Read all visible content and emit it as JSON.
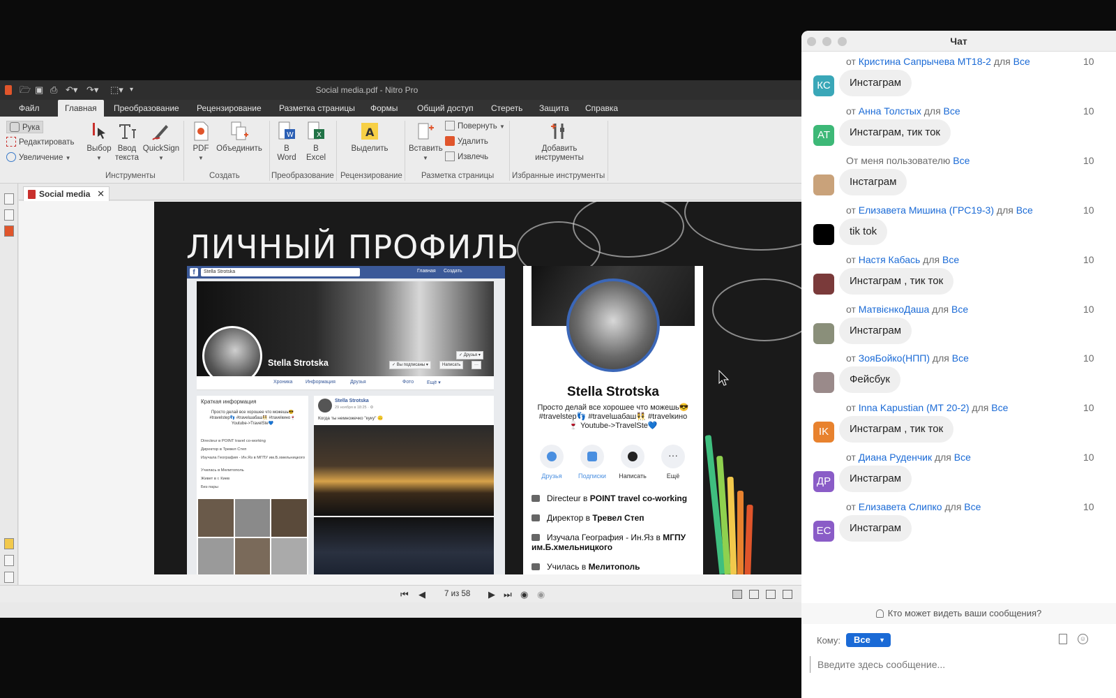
{
  "nitro": {
    "window_title": "Social media.pdf - Nitro Pro",
    "menu_tabs": [
      "Файл",
      "Главная",
      "Преобразование",
      "Рецензирование",
      "Разметка страницы",
      "Формы",
      "Общий доступ",
      "Стереть",
      "Защита",
      "Справка"
    ],
    "active_tab": "Главная",
    "ribbon": {
      "hand": "Рука",
      "edit": "Редактировать",
      "zoom": "Увеличение",
      "select": "Выбор",
      "type_text_1": "Ввод",
      "type_text_2": "текста",
      "quicksign": "QuickSign",
      "pdf": "PDF",
      "combine": "Объединить",
      "to_word_1": "В",
      "to_word_2": "Word",
      "to_excel_1": "В",
      "to_excel_2": "Excel",
      "highlight": "Выделить",
      "insert": "Вставить",
      "rotate": "Повернуть",
      "delete": "Удалить",
      "extract": "Извлечь",
      "add_tools_1": "Добавить",
      "add_tools_2": "инструменты",
      "groups": [
        "Инструменты",
        "Создать",
        "Преобразование",
        "Рецензирование",
        "Разметка страницы",
        "Избранные инструменты"
      ]
    },
    "doc_tab": "Social media",
    "page_indicator": "7 из 58",
    "slide": {
      "title": "ЛИЧНЫЙ ПРОФИЛЬ",
      "facebook": {
        "search": "Stella Strotska",
        "top_links": [
          "Главная",
          "Создать"
        ],
        "name": "Stella Strotska",
        "buttons": [
          "✓ Друзья ▾",
          "✓ Вы подписаны ▾",
          "Написать",
          "···"
        ],
        "nav": [
          "Хроника",
          "Информация",
          "Друзья",
          "Фото",
          "Ещё ▾"
        ],
        "intro_title": "Краткая информация",
        "intro_desc": "Просто делай все хорошее что можешь😎 #travelstep👣 #travelшабаш👯 #travelкино🍷 Youtube->TravelSte💙",
        "intro_lines": [
          "Directeur в POINT travel co-working",
          "Директор в Тревел Степ",
          "Изучала География - Ин.Яз в МГПУ им.Б.хмельницкого",
          "Училась в Мелитополь",
          "Живет в г. Киев",
          "Без пары"
        ],
        "post_author": "Stella Strotska",
        "post_time": "29 ноября в 18:25 · ⚙",
        "post_text": "Когда ты немножечко \"куку\" 🙃"
      },
      "instagram": {
        "name": "Stella Strotska",
        "bio": "Просто делай все хорошее что можешь😎 #travelstep👣 #travelшабаш👯 #travelкино🍷 Youtube->TravelSte💙",
        "actions": [
          "Друзья",
          "Подписки",
          "Написать",
          "Ещё"
        ],
        "lines": [
          {
            "pre": "Directeur в ",
            "bold": "POINT  travel co-working"
          },
          {
            "pre": "Директор в ",
            "bold": "Тревел Степ"
          },
          {
            "pre": "Изучала География - Ин.Яз в ",
            "bold": "МГПУ им.Б.хмельницкого"
          },
          {
            "pre": "Училась в ",
            "bold": "Мелитополь"
          }
        ]
      }
    }
  },
  "chat": {
    "title": "Чат",
    "messages": [
      {
        "prefix": "от ",
        "sender": "Кристина Сапрычева МТ18-2",
        "mid": " для ",
        "to": "Все",
        "time": "10",
        "text": "Инстаграм",
        "avatar_initials": "КС",
        "avatar_color": "#3aa7b8"
      },
      {
        "prefix": "от ",
        "sender": "Анна Толстых",
        "mid": " для ",
        "to": "Все",
        "time": "10",
        "text": "Инстаграм, тик ток",
        "avatar_initials": "АТ",
        "avatar_color": "#3db877"
      },
      {
        "prefix": "От меня пользователю ",
        "sender": "",
        "mid": "",
        "to": "Все",
        "time": "10",
        "text": "Інстаграм",
        "avatar_initials": "",
        "avatar_color": "#c9a27a"
      },
      {
        "prefix": "от ",
        "sender": "Елизавета Мишина (ГРС19-3)",
        "mid": " для ",
        "to": "Все",
        "time": "10",
        "text": "tik tok",
        "avatar_initials": "",
        "avatar_color": "#000000"
      },
      {
        "prefix": "от ",
        "sender": "Настя Кабась",
        "mid": " для ",
        "to": "Все",
        "time": "10",
        "text": "Инстаграм , тик ток",
        "avatar_initials": "",
        "avatar_color": "#7a3a3a"
      },
      {
        "prefix": "от ",
        "sender": "МатвієнкоДаша",
        "mid": " для ",
        "to": "Все",
        "time": "10",
        "text": "Инстаграм",
        "avatar_initials": "",
        "avatar_color": "#8a8f7a"
      },
      {
        "prefix": "от ",
        "sender": "ЗояБойко(НПП)",
        "mid": " для ",
        "to": "Все",
        "time": "10",
        "text": "Фейсбук",
        "avatar_initials": "",
        "avatar_color": "#9a8a8a"
      },
      {
        "prefix": "от ",
        "sender": "Inna Kapustian (МТ 20-2)",
        "mid": " для ",
        "to": "Все",
        "time": "10",
        "text": "Инстаграм , тик ток",
        "avatar_initials": "IK",
        "avatar_color": "#e8822e"
      },
      {
        "prefix": "от ",
        "sender": "Диана Руденчик",
        "mid": " для ",
        "to": "Все",
        "time": "10",
        "text": "Инстаграм",
        "avatar_initials": "ДР",
        "avatar_color": "#8a5cc7"
      },
      {
        "prefix": "от ",
        "sender": "Елизавета Слипко ",
        "mid": " для ",
        "to": "Все",
        "time": "10",
        "text": "Инстаграм",
        "avatar_initials": "ЕС",
        "avatar_color": "#8a5cc7"
      }
    ],
    "who_can_see": "Кто может видеть ваши сообщения?",
    "to_label": "Кому:",
    "to_value": "Все",
    "input_placeholder": "Введите здесь сообщение..."
  }
}
